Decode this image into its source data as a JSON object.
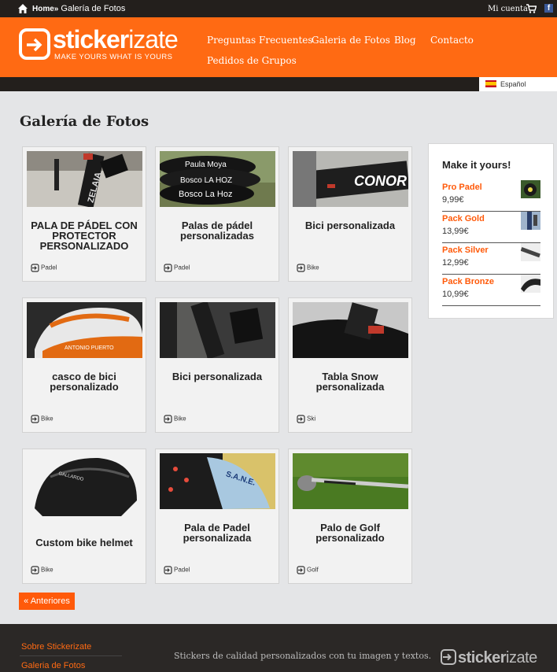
{
  "topbar": {
    "home_label": "Home»",
    "current": "Galería de Fotos",
    "account": "Mi cuenta",
    "facebook": "f"
  },
  "header": {
    "logo_main": "sticker",
    "logo_accent": "izate",
    "logo_tagline": "MAKE YOURS WHAT IS YOURS",
    "nav": [
      {
        "label": "Preguntas Frecuentes"
      },
      {
        "label": "Galeria de Fotos"
      },
      {
        "label": "Blog"
      },
      {
        "label": "Contacto"
      },
      {
        "label": "Pedidos de Grupos"
      }
    ]
  },
  "language": {
    "label": "Español"
  },
  "page": {
    "title": "Galería de Fotos"
  },
  "gallery": [
    {
      "title": "PALA DE PÁDEL CON PROTECTOR PERSONALIZADO",
      "category": "Padel",
      "thumb_text": "ZELAIA"
    },
    {
      "title": "Palas de pádel personalizadas",
      "category": "Padel",
      "thumb_text": "Paula Moya",
      "thumb_text2": "Bosco LA HOZ",
      "thumb_text3": "Bosco La Hoz"
    },
    {
      "title": "Bici personalizada",
      "category": "Bike",
      "thumb_text": "CONOR"
    },
    {
      "title": "casco de bici personalizado",
      "category": "Bike",
      "thumb_text": "ANTONIO PUERTO"
    },
    {
      "title": "Bici personalizada",
      "category": "Bike"
    },
    {
      "title": "Tabla Snow personalizada",
      "category": "Ski"
    },
    {
      "title": "Custom bike helmet",
      "category": "Bike",
      "thumb_text": "GALLARDO"
    },
    {
      "title": "Pala de Padel personalizada",
      "category": "Padel",
      "thumb_text": "S.A.N.E."
    },
    {
      "title": "Palo de Golf personalizado",
      "category": "Golf"
    }
  ],
  "pagination": {
    "older": "« Anteriores"
  },
  "widget": {
    "title": "Make it yours!",
    "products": [
      {
        "name": "Pro Padel",
        "price": "9,99€"
      },
      {
        "name": "Pack Gold",
        "price": "13,99€"
      },
      {
        "name": "Pack Silver",
        "price": "12,99€"
      },
      {
        "name": "Pack Bronze",
        "price": "10,99€"
      }
    ]
  },
  "footer": {
    "links": [
      {
        "label": "Sobre Stickerizate"
      },
      {
        "label": "Galeria de Fotos"
      }
    ],
    "tagline": "Stickers de calidad personalizados con tu imagen y textos.",
    "logo_main": "sticker",
    "logo_accent": "izate"
  },
  "colors": {
    "brand_orange": "#ff6a13",
    "dark": "#231f1c",
    "background": "#e4e5e7"
  }
}
